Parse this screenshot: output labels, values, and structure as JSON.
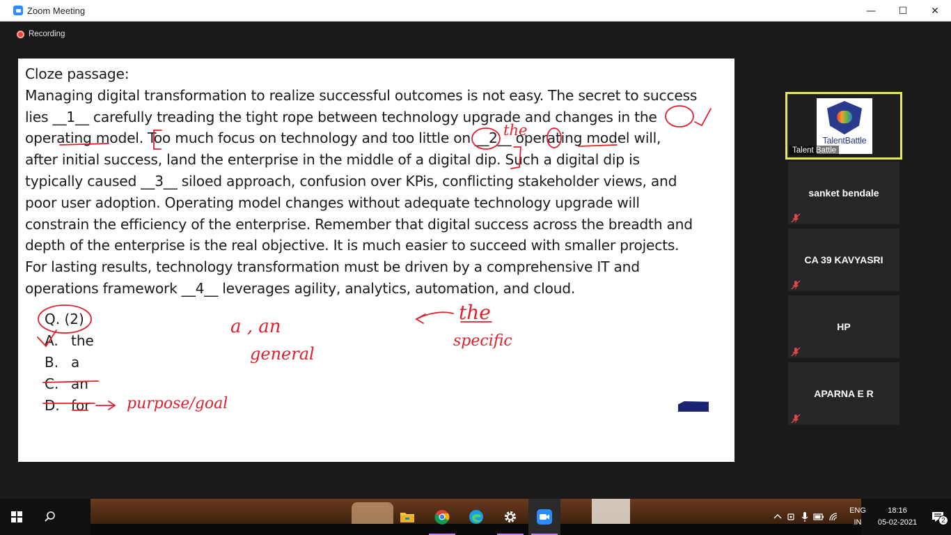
{
  "window": {
    "title": "Zoom Meeting",
    "minimize": "—",
    "maximize": "☐",
    "close": "✕"
  },
  "meeting": {
    "recording_label": "Recording"
  },
  "slide": {
    "heading": "Cloze passage:",
    "lines": [
      "Managing digital transformation to realize successful outcomes is not easy. The secret to success",
      "lies __1__ carefully treading the tight rope between technology upgrade and changes in the",
      "operating model. Too much focus on technology and too little on __2__ operating model will,",
      "after initial success, land the enterprise in the middle of a digital dip. Such a digital dip is",
      "typically caused __3__ siloed approach, confusion over KPis, conflicting stakeholder views, and",
      "poor user adoption. Operating model changes without adequate technology upgrade will",
      "constrain the efficiency of the enterprise. Remember that digital success across the breadth and",
      "depth of the enterprise is the real objective. It is much easier to succeed with smaller projects.",
      "For lasting results, technology transformation must be driven by a comprehensive IT and",
      "operations framework __4__ leverages agility, analytics, automation, and cloud."
    ],
    "question": "Q. (2)",
    "options": [
      {
        "key": "A.",
        "text": "the"
      },
      {
        "key": "B.",
        "text": "a"
      },
      {
        "key": "C.",
        "text": "an"
      },
      {
        "key": "D.",
        "text": "for"
      }
    ],
    "annotations": {
      "above_blank2": "the",
      "a_an": "a , an",
      "general": "general",
      "the_right": "the",
      "specific": "specific",
      "purpose": "purpose/goal"
    },
    "ink_color": "#e0202c"
  },
  "participants": {
    "active": {
      "name": "Talent Battle",
      "logo_text": "TalentBattle"
    },
    "others": [
      {
        "name": "sanket bendale"
      },
      {
        "name": "CA 39 KAVYASRI"
      },
      {
        "name": "HP"
      },
      {
        "name": "APARNA E R"
      }
    ]
  },
  "taskbar": {
    "apps": [
      "file-explorer",
      "chrome",
      "edge",
      "settings",
      "zoom"
    ],
    "lang_top": "ENG",
    "lang_bottom": "IN",
    "time": "18:16",
    "date": "05-02-2021",
    "notifications": "2"
  }
}
